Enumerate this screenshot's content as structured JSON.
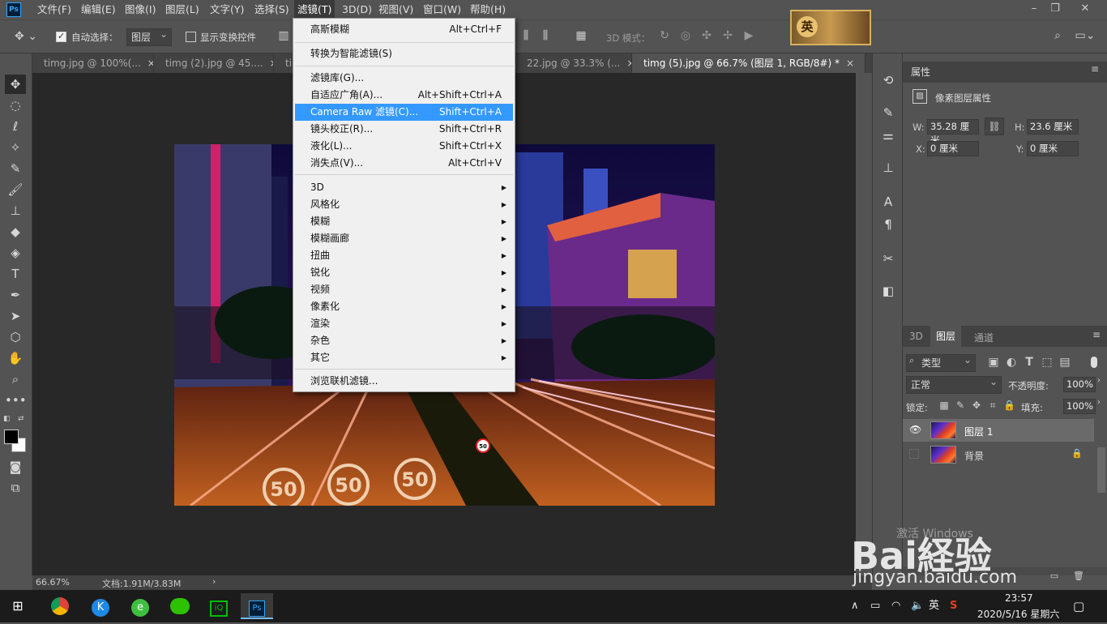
{
  "menubar": {
    "logo": "Ps",
    "items": [
      "文件(F)",
      "编辑(E)",
      "图像(I)",
      "图层(L)",
      "文字(Y)",
      "选择(S)",
      "滤镜(T)",
      "3D(D)",
      "视图(V)",
      "窗口(W)",
      "帮助(H)"
    ],
    "active_item": "滤镜(T)",
    "game_banner_text": "英"
  },
  "options_bar": {
    "auto_select_label": "自动选择：",
    "auto_select_target": "图层",
    "show_transform_label": "显示变换控件",
    "mode_3d_label": "3D 模式："
  },
  "doc_tabs": [
    {
      "label": "timg.jpg @ 100%(...",
      "close": "×"
    },
    {
      "label": "timg (2).jpg @ 45....",
      "close": "×"
    },
    {
      "label": "tim",
      "close": ""
    },
    {
      "label": "22.jpg @ 33.3% (...",
      "close": "×"
    },
    {
      "label": "timg (5).jpg @ 66.7% (图层 1, RGB/8#) *",
      "close": "×"
    }
  ],
  "filter_menu": {
    "groups": [
      [
        {
          "label": "高斯模糊",
          "shortcut": "Alt+Ctrl+F"
        }
      ],
      [
        {
          "label": "转换为智能滤镜(S)",
          "shortcut": ""
        }
      ],
      [
        {
          "label": "滤镜库(G)...",
          "shortcut": ""
        },
        {
          "label": "自适应广角(A)...",
          "shortcut": "Alt+Shift+Ctrl+A"
        },
        {
          "label": "Camera Raw 滤镜(C)...",
          "shortcut": "Shift+Ctrl+A"
        },
        {
          "label": "镜头校正(R)...",
          "shortcut": "Shift+Ctrl+R"
        },
        {
          "label": "液化(L)...",
          "shortcut": "Shift+Ctrl+X"
        },
        {
          "label": "消失点(V)...",
          "shortcut": "Alt+Ctrl+V"
        }
      ],
      [
        {
          "label": "3D",
          "submenu": true
        },
        {
          "label": "风格化",
          "submenu": true
        },
        {
          "label": "模糊",
          "submenu": true
        },
        {
          "label": "模糊画廊",
          "submenu": true
        },
        {
          "label": "扭曲",
          "submenu": true
        },
        {
          "label": "锐化",
          "submenu": true
        },
        {
          "label": "视频",
          "submenu": true
        },
        {
          "label": "像素化",
          "submenu": true
        },
        {
          "label": "渲染",
          "submenu": true
        },
        {
          "label": "杂色",
          "submenu": true
        },
        {
          "label": "其它",
          "submenu": true
        }
      ],
      [
        {
          "label": "浏览联机滤镜...",
          "shortcut": ""
        }
      ]
    ],
    "highlighted": "Camera Raw 滤镜(C)..."
  },
  "image_signs": [
    "50",
    "50",
    "50",
    "50"
  ],
  "status_bar": {
    "zoom": "66.67%",
    "doc_info": "文档:1.91M/3.83M",
    "arrow": "›"
  },
  "properties_panel": {
    "title": "属性",
    "subtitle": "像素图层属性",
    "w_label": "W:",
    "w_value": "35.28 厘米",
    "h_label": "H:",
    "h_value": "23.6 厘米",
    "x_label": "X:",
    "x_value": "0 厘米",
    "y_label": "Y:",
    "y_value": "0 厘米"
  },
  "layers_panel": {
    "tabs": [
      "3D",
      "图层",
      "通道"
    ],
    "active_tab": "图层",
    "filter_kind": "类型",
    "blend_mode": "正常",
    "opacity_label": "不透明度:",
    "opacity_value": "100%",
    "lock_label": "锁定:",
    "fill_label": "填充:",
    "fill_value": "100%",
    "layers": [
      {
        "name": "图层 1",
        "visible": true,
        "selected": true,
        "locked": false
      },
      {
        "name": "背景",
        "visible": false,
        "selected": false,
        "locked": true
      }
    ]
  },
  "taskbar": {
    "time": "23:57",
    "date": "2020/5/16 星期六",
    "ime": "英",
    "apps": [
      "chrome",
      "kugou",
      "browser-360",
      "wechat",
      "iqiyi",
      "photoshop"
    ]
  },
  "watermark": {
    "main": "Bai経验",
    "url": "jingyan.baidu.com",
    "activate": "激活 Windows"
  }
}
